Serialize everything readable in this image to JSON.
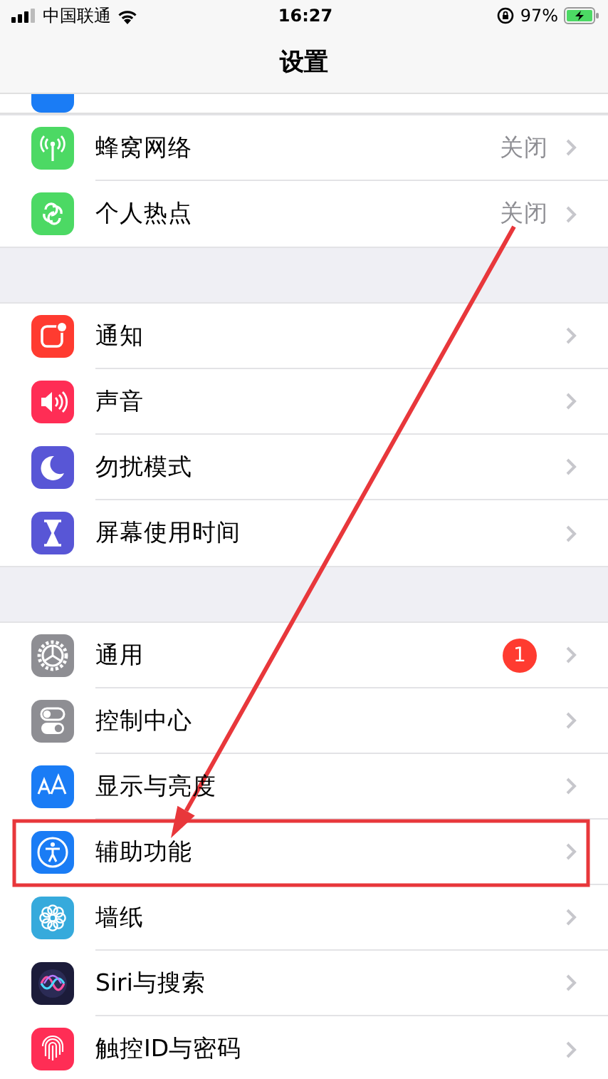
{
  "status_bar": {
    "carrier": "中国联通",
    "time": "16:27",
    "battery": "97%"
  },
  "title": "设置",
  "sections": [
    {
      "rows": [
        {
          "label": "蜂窝网络",
          "value": "关闭",
          "highlighted": false,
          "arrow_start": false
        },
        {
          "label": "个人热点",
          "value": "关闭",
          "highlighted": false,
          "arrow_start": true
        }
      ]
    },
    {
      "rows": [
        {
          "label": "通知",
          "highlighted": false,
          "arrow_start": false
        },
        {
          "label": "声音",
          "highlighted": false,
          "arrow_start": false
        },
        {
          "label": "勿扰模式",
          "highlighted": false,
          "arrow_start": false
        },
        {
          "label": "屏幕使用时间",
          "highlighted": false,
          "arrow_start": false
        }
      ]
    },
    {
      "rows": [
        {
          "label": "通用",
          "badge": "1",
          "highlighted": false,
          "arrow_start": false
        },
        {
          "label": "控制中心",
          "highlighted": false,
          "arrow_start": false
        },
        {
          "label": "显示与亮度",
          "highlighted": false,
          "arrow_start": false
        },
        {
          "label": "辅助功能",
          "highlighted": true,
          "arrow_start": false
        },
        {
          "label": "墙纸",
          "highlighted": false,
          "arrow_start": false
        },
        {
          "label": "Siri与搜索",
          "highlighted": false,
          "arrow_start": false
        },
        {
          "label": "触控ID与密码",
          "highlighted": false,
          "arrow_start": false
        }
      ]
    }
  ]
}
